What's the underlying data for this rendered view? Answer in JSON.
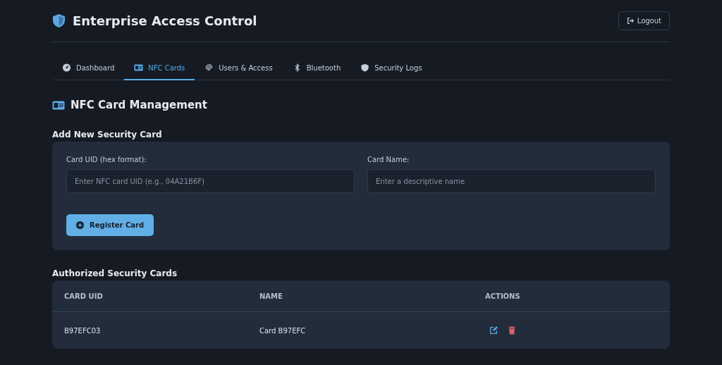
{
  "header": {
    "title": "Enterprise Access Control",
    "logout": "Logout"
  },
  "tabs": [
    {
      "label": "Dashboard",
      "selected": false
    },
    {
      "label": "NFC Cards",
      "selected": true
    },
    {
      "label": "Users & Access",
      "selected": false
    },
    {
      "label": "Bluetooth",
      "selected": false
    },
    {
      "label": "Security Logs",
      "selected": false
    }
  ],
  "page_title": "NFC Card Management",
  "form": {
    "heading": "Add New Security Card",
    "fields": [
      {
        "label": "Card UID (hex format):",
        "placeholder": "Enter NFC card UID (e.g., 04A21B6F)"
      },
      {
        "label": "Card Name:",
        "placeholder": "Enter a descriptive name"
      }
    ],
    "submit": "Register Card"
  },
  "table": {
    "heading": "Authorized Security Cards",
    "columns": [
      "CARD UID",
      "NAME",
      "ACTIONS"
    ],
    "rows": [
      {
        "uid": "B97EFC03",
        "name": "Card B97EFC"
      }
    ]
  }
}
